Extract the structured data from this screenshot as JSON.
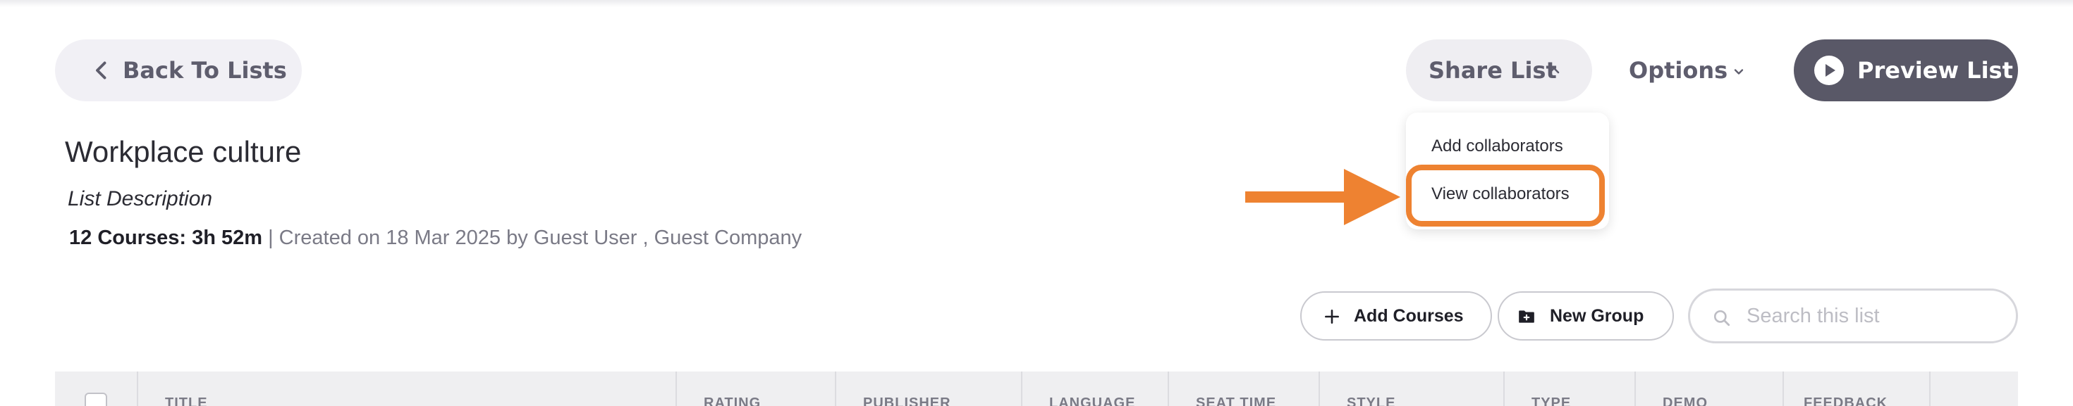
{
  "header": {
    "back_label": "Back To Lists",
    "share_label": "Share List",
    "options_label": "Options",
    "preview_label": "Preview List"
  },
  "share_menu": {
    "items": [
      "Add collaborators",
      "View collaborators"
    ],
    "highlighted": "View collaborators"
  },
  "list": {
    "title": "Workplace culture",
    "description": "List Description",
    "summary": "12 Courses: 3h 52m",
    "created": " | Created on 18 Mar 2025 by Guest User , Guest Company"
  },
  "toolbar": {
    "add_courses_label": "Add Courses",
    "new_group_label": "New Group",
    "search_placeholder": "Search this list"
  },
  "table": {
    "columns": [
      "TITLE",
      "RATING",
      "PUBLISHER",
      "LANGUAGE",
      "SEAT TIME",
      "STYLE",
      "TYPE",
      "DEMO",
      "FEEDBACK"
    ]
  },
  "colors": {
    "accent_orange": "#ee8231",
    "dark_button": "#595867",
    "pill_bg": "#f1f0f5",
    "text_muted": "#7a7a86"
  },
  "icons": [
    "chevron-left-icon",
    "chevron-up-icon",
    "chevron-down-icon",
    "play-icon",
    "plus-icon",
    "folder-plus-icon",
    "search-icon",
    "arrow-right-icon"
  ]
}
